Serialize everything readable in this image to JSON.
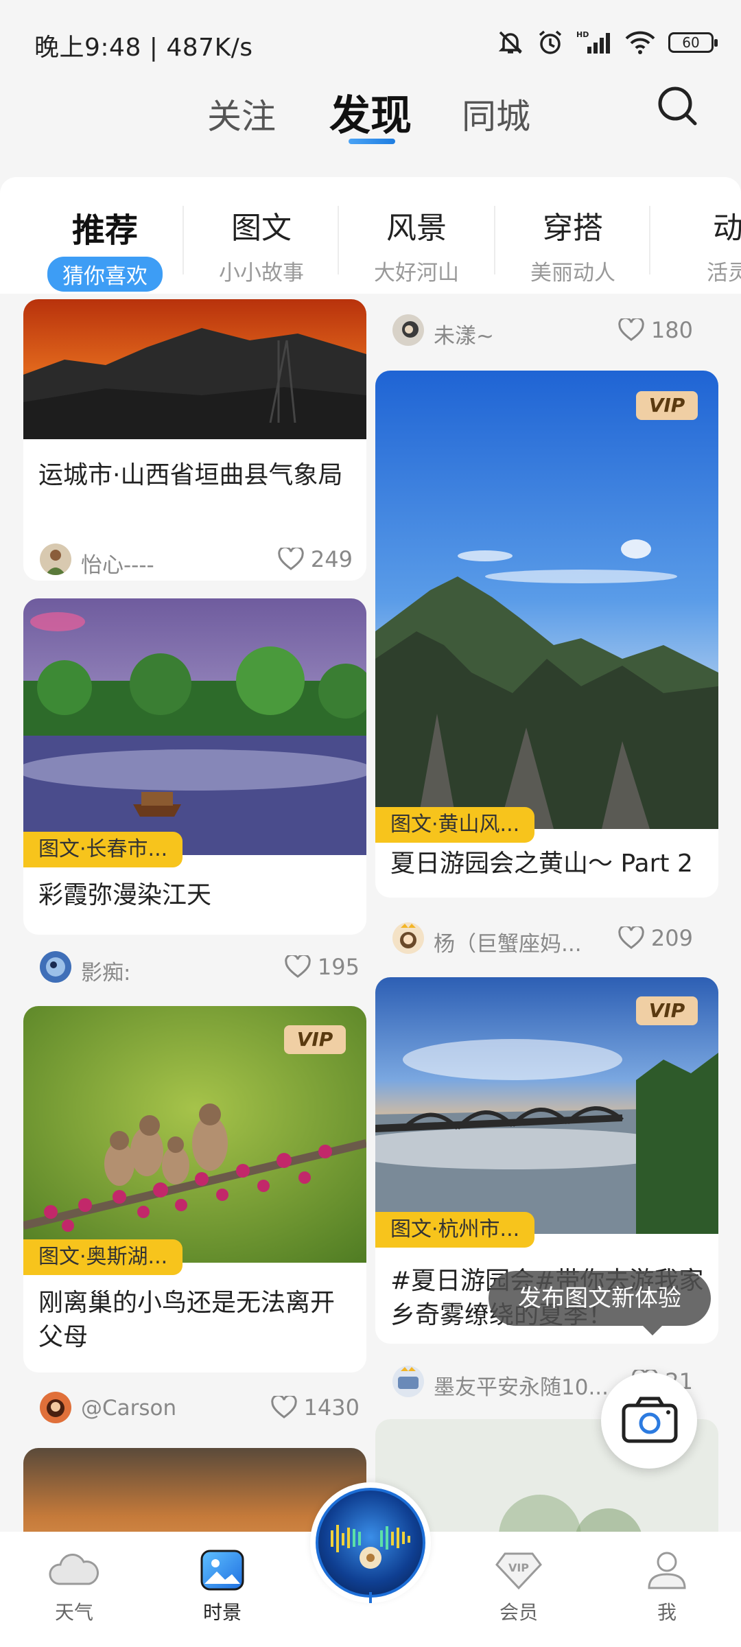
{
  "status_bar": {
    "time": "晚上9:48 | 487K/s",
    "battery": "60"
  },
  "top_tabs": [
    {
      "label": "关注",
      "active": false
    },
    {
      "label": "发现",
      "active": true
    },
    {
      "label": "同城",
      "active": false
    }
  ],
  "categories": [
    {
      "title": "推荐",
      "subtitle": "猜你喜欢",
      "active": true
    },
    {
      "title": "图文",
      "subtitle": "小小故事",
      "active": false
    },
    {
      "title": "风景",
      "subtitle": "大好河山",
      "active": false
    },
    {
      "title": "穿搭",
      "subtitle": "美丽动人",
      "active": false
    },
    {
      "title": "动",
      "subtitle": "活灵",
      "active": false
    }
  ],
  "left_column": [
    {
      "title": "运城市·山西省垣曲县气象局",
      "author": "怡心----",
      "likes": "249"
    },
    {
      "tag": "图文·长春市...",
      "title": "彩霞弥漫染江天",
      "author": "影痴:",
      "likes": "195"
    },
    {
      "tag": "图文·奥斯湖...",
      "vip": "VIP",
      "title": "刚离巢的小鸟还是无法离开父母",
      "author": "@Carson",
      "likes": "1430"
    }
  ],
  "right_column": [
    {
      "author": "未漾~",
      "likes": "180"
    },
    {
      "tag": "图文·黄山风...",
      "vip": "VIP",
      "title": "夏日游园会之黄山～ Part 2",
      "author": "杨（巨蟹座妈...",
      "likes": "209"
    },
    {
      "tag": "图文·杭州市...",
      "vip": "VIP",
      "title": "#夏日游园会#带你去游我家乡奇雾缭绕的夏季！",
      "author": "墨友平安永随10...",
      "likes": "21"
    }
  ],
  "tooltip": "发布图文新体验",
  "bottom_nav": [
    {
      "label": "天气",
      "icon": "cloud-icon",
      "active": false
    },
    {
      "label": "时景",
      "icon": "picture-icon",
      "active": true
    },
    {
      "label": "会员",
      "icon": "vip-diamond-icon",
      "active": false
    },
    {
      "label": "我",
      "icon": "person-icon",
      "active": false
    }
  ]
}
